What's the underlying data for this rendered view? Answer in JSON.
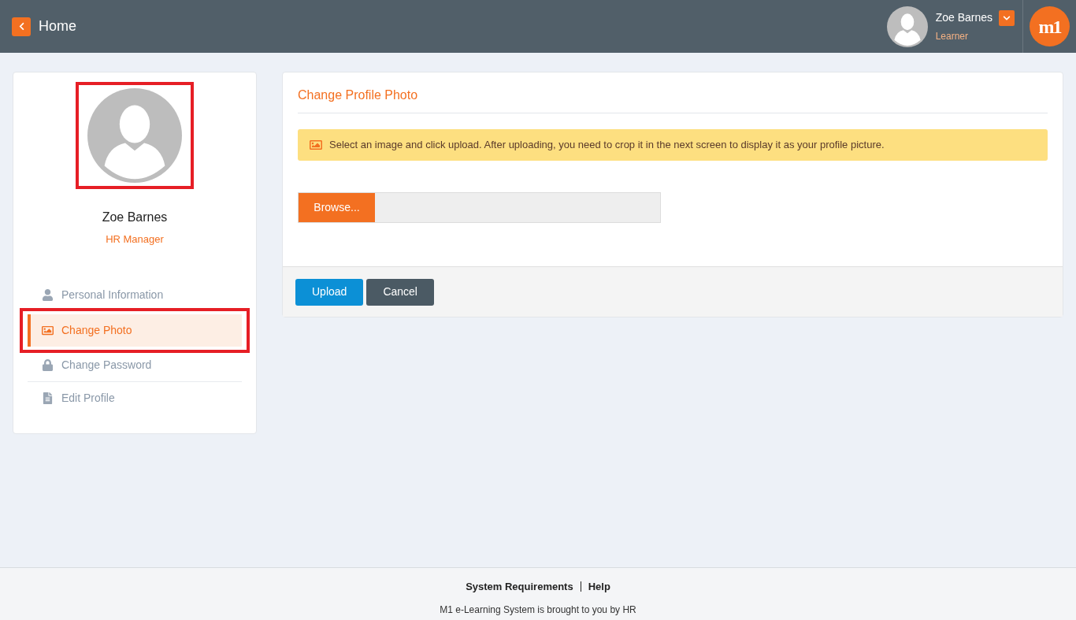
{
  "header": {
    "back_label": "Home",
    "user": {
      "name": "Zoe Barnes",
      "role": "Learner"
    },
    "logo": "m1"
  },
  "profile": {
    "name": "Zoe Barnes",
    "title": "HR Manager"
  },
  "menu": [
    {
      "label": "Personal Information",
      "kind": "user",
      "selected": false
    },
    {
      "label": "Change Photo",
      "kind": "image",
      "selected": true
    },
    {
      "label": "Change Password",
      "kind": "lock",
      "selected": false
    },
    {
      "label": "Edit Profile",
      "kind": "file",
      "selected": false
    }
  ],
  "panel": {
    "title": "Change Profile Photo",
    "notice": "Select an image and click upload. After uploading, you need to crop it in the next screen to display it as your profile picture.",
    "browse_label": "Browse...",
    "buttons": [
      {
        "label": "Upload",
        "kind": "primary"
      },
      {
        "label": "Cancel",
        "kind": "secondary"
      }
    ]
  },
  "footer": {
    "links": [
      "System Requirements",
      "Help"
    ],
    "note": "M1 e-Learning System is brought to you by HR"
  }
}
